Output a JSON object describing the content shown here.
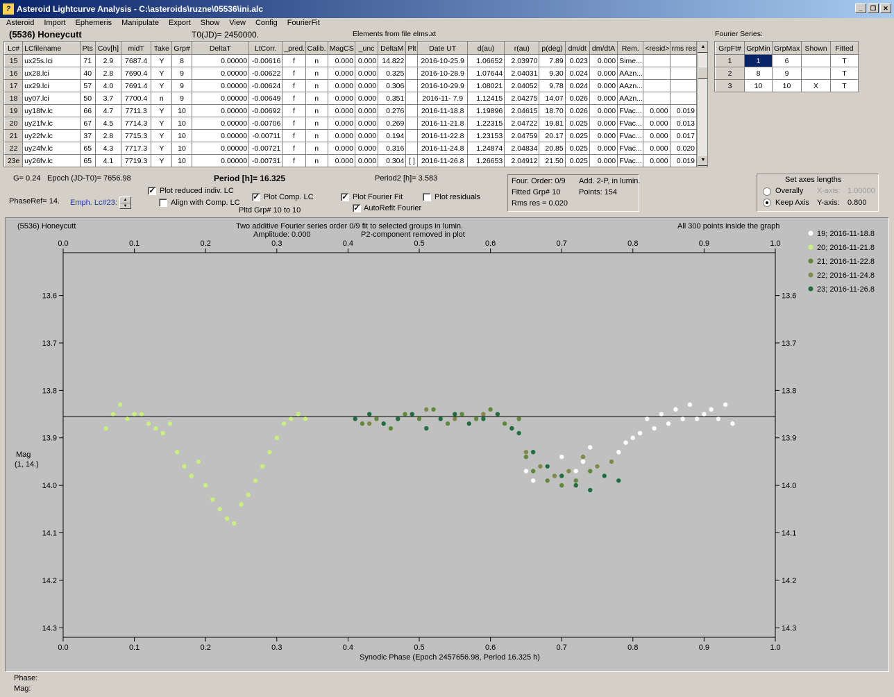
{
  "window": {
    "title": "Asteroid Lightcurve Analysis - C:\\asteroids\\ruzne\\05536\\ini.alc",
    "minimize": "_",
    "restore": "❐",
    "close": "✕"
  },
  "menu": [
    "Asteroid",
    "Import",
    "Ephemeris",
    "Manipulate",
    "Export",
    "Show",
    "View",
    "Config",
    "FourierFit"
  ],
  "header": {
    "asteroid": "(5536) Honeycutt",
    "t0": "T0(JD)= 2450000.",
    "elements": "Elements from file elms.xt",
    "fourier_series_label": "Fourier Series:"
  },
  "lc_table": {
    "columns": [
      "Lc#",
      "LCfilename",
      "Pts",
      "Cov[h]",
      "midT",
      "Take",
      "Grp#",
      "DeltaT",
      "LtCorr.",
      "_pred.",
      "Calib.",
      "MagCS",
      "_unc",
      "DeltaM",
      "Plt",
      "Date UT",
      "d(au)",
      "r(au)",
      "p(deg)",
      "dm/dt",
      "dm/dtA",
      "Rem.",
      "<resid>",
      "rms res"
    ],
    "rows": [
      [
        "15",
        "ux25s.lci",
        "71",
        "2.9",
        "7687.4",
        "Y",
        "8",
        "0.00000",
        "-0.00616",
        "f",
        "n",
        "0.000",
        "0.000",
        "14.822",
        "",
        "2016-10-25.9",
        "1.06652",
        "2.03970",
        "7.89",
        "0.023",
        "0.000",
        "Sime...",
        "",
        ""
      ],
      [
        "16",
        "ux28.lci",
        "40",
        "2.8",
        "7690.4",
        "Y",
        "9",
        "0.00000",
        "-0.00622",
        "f",
        "n",
        "0.000",
        "0.000",
        "0.325",
        "",
        "2016-10-28.9",
        "1.07644",
        "2.04031",
        "9.30",
        "0.024",
        "0.000",
        "AAzn...",
        "",
        ""
      ],
      [
        "17",
        "ux29.lci",
        "57",
        "4.0",
        "7691.4",
        "Y",
        "9",
        "0.00000",
        "-0.00624",
        "f",
        "n",
        "0.000",
        "0.000",
        "0.306",
        "",
        "2016-10-29.9",
        "1.08021",
        "2.04052",
        "9.78",
        "0.024",
        "0.000",
        "AAzn...",
        "",
        ""
      ],
      [
        "18",
        "uy07.lci",
        "50",
        "3.7",
        "7700.4",
        "n",
        "9",
        "0.00000",
        "-0.00649",
        "f",
        "n",
        "0.000",
        "0.000",
        "0.351",
        "",
        "2016-11- 7.9",
        "1.12415",
        "2.04275",
        "14.07",
        "0.026",
        "0.000",
        "AAzn...",
        "",
        ""
      ],
      [
        "19",
        "uy18fv.lc",
        "66",
        "4.7",
        "7711.3",
        "Y",
        "10",
        "0.00000",
        "-0.00692",
        "f",
        "n",
        "0.000",
        "0.000",
        "0.276",
        "",
        "2016-11-18.8",
        "1.19896",
        "2.04615",
        "18.70",
        "0.026",
        "0.000",
        "FVac...",
        "0.000",
        "0.019"
      ],
      [
        "20",
        "uy21fv.lc",
        "67",
        "4.5",
        "7714.3",
        "Y",
        "10",
        "0.00000",
        "-0.00706",
        "f",
        "n",
        "0.000",
        "0.000",
        "0.269",
        "",
        "2016-11-21.8",
        "1.22315",
        "2.04722",
        "19.81",
        "0.025",
        "0.000",
        "FVac...",
        "0.000",
        "0.013"
      ],
      [
        "21",
        "uy22fv.lc",
        "37",
        "2.8",
        "7715.3",
        "Y",
        "10",
        "0.00000",
        "-0.00711",
        "f",
        "n",
        "0.000",
        "0.000",
        "0.194",
        "",
        "2016-11-22.8",
        "1.23153",
        "2.04759",
        "20.17",
        "0.025",
        "0.000",
        "FVac...",
        "0.000",
        "0.017"
      ],
      [
        "22",
        "uy24fv.lc",
        "65",
        "4.3",
        "7717.3",
        "Y",
        "10",
        "0.00000",
        "-0.00721",
        "f",
        "n",
        "0.000",
        "0.000",
        "0.316",
        "",
        "2016-11-24.8",
        "1.24874",
        "2.04834",
        "20.85",
        "0.025",
        "0.000",
        "FVac...",
        "0.000",
        "0.020"
      ],
      [
        "23e",
        "uy26fv.lc",
        "65",
        "4.1",
        "7719.3",
        "Y",
        "10",
        "0.00000",
        "-0.00731",
        "f",
        "n",
        "0.000",
        "0.000",
        "0.304",
        "[ ]",
        "2016-11-26.8",
        "1.26653",
        "2.04912",
        "21.50",
        "0.025",
        "0.000",
        "FVac...",
        "0.000",
        "0.019"
      ]
    ]
  },
  "fourier_table": {
    "columns": [
      "GrpFt#",
      "GrpMin",
      "GrpMax",
      "Shown",
      "Fitted"
    ],
    "rows": [
      [
        "1",
        "1",
        "6",
        "",
        "T"
      ],
      [
        "2",
        "8",
        "9",
        "",
        "T"
      ],
      [
        "3",
        "10",
        "10",
        "X",
        "T"
      ]
    ]
  },
  "controls": {
    "g": "G= 0.24",
    "epoch": "Epoch (JD-T0)= 7656.98",
    "period": "Period [h]= 16.325",
    "period2": "Period2 [h]= 3.583",
    "phaseref": "PhaseRef= 14.",
    "emph": "Emph. Lc#23:",
    "plot_reduced": "Plot reduced indiv. LC",
    "align_comp": "Align with Comp. LC",
    "plot_comp": "Plot Comp. LC",
    "pltd_grp": "Pltd Grp#  10 to   10",
    "plot_fourier": "Plot Fourier Fit",
    "autorefit": "AutoRefit Fourier",
    "plot_residuals": "Plot residuals",
    "plot_reduced_checked": true,
    "align_comp_checked": false,
    "plot_comp_checked": true,
    "plot_fourier_checked": true,
    "autorefit_checked": true,
    "plot_residuals_checked": false,
    "four_order": "Four. Order:  0/9",
    "add2p": "Add. 2-P, in lumin.",
    "fitted_grp": "Fitted Grp# 10",
    "points": "Points: 154",
    "rms": "Rms res     = 0.020",
    "axes_title": "Set axes lengths",
    "overally": "Overally",
    "keep_axis": "Keep Axis",
    "xaxis": "X-axis:",
    "xaxis_val": "1.00000",
    "yaxis": "Y-axis:",
    "yaxis_val": "0.800"
  },
  "plot": {
    "name": "(5536) Honeycutt",
    "info1": "Two additive Fourier series order 0/9 fit to selected groups in lumin.",
    "info2": "Amplitude: 0.000",
    "info3": "P2-component removed in plot",
    "inside": "All 300 points inside the graph",
    "ylabel1": "Mag",
    "ylabel2": "(1, 14.)",
    "xlabel": "Synodic Phase (Epoch 2457656.98, Period 16.325 h)"
  },
  "chart_data": {
    "type": "scatter",
    "title": "(5536) Honeycutt",
    "xlabel": "Synodic Phase (Epoch 2457656.98, Period 16.325 h)",
    "ylabel": "Mag (1, 14.)",
    "xlim": [
      0,
      1
    ],
    "ylim": [
      14.32,
      13.51
    ],
    "y_inverted": true,
    "xticks": [
      "0.0",
      "0.1",
      "0.2",
      "0.3",
      "0.4",
      "0.5",
      "0.6",
      "0.7",
      "0.8",
      "0.9",
      "1.0"
    ],
    "yticks": [
      "13.6",
      "13.7",
      "13.8",
      "13.9",
      "14.0",
      "14.1",
      "14.2",
      "14.3"
    ],
    "fit_line_mag": 13.855,
    "legend": "right",
    "series": [
      {
        "name": "19; 2016-11-18.8",
        "color": "#ffffff",
        "points": [
          [
            0.65,
            13.97
          ],
          [
            0.66,
            13.99
          ],
          [
            0.68,
            13.96
          ],
          [
            0.7,
            13.94
          ],
          [
            0.72,
            13.97
          ],
          [
            0.73,
            13.95
          ],
          [
            0.74,
            13.92
          ],
          [
            0.75,
            13.96
          ],
          [
            0.76,
            13.98
          ],
          [
            0.77,
            13.95
          ],
          [
            0.78,
            13.93
          ],
          [
            0.79,
            13.91
          ],
          [
            0.8,
            13.9
          ],
          [
            0.81,
            13.89
          ],
          [
            0.82,
            13.86
          ],
          [
            0.83,
            13.88
          ],
          [
            0.84,
            13.85
          ],
          [
            0.85,
            13.87
          ],
          [
            0.86,
            13.84
          ],
          [
            0.87,
            13.86
          ],
          [
            0.88,
            13.83
          ],
          [
            0.89,
            13.86
          ],
          [
            0.9,
            13.85
          ],
          [
            0.91,
            13.84
          ],
          [
            0.92,
            13.86
          ],
          [
            0.93,
            13.83
          ],
          [
            0.94,
            13.87
          ]
        ]
      },
      {
        "name": "20; 2016-11-21.8",
        "color": "#c8f07a",
        "points": [
          [
            0.06,
            13.88
          ],
          [
            0.07,
            13.85
          ],
          [
            0.08,
            13.83
          ],
          [
            0.09,
            13.86
          ],
          [
            0.1,
            13.85
          ],
          [
            0.11,
            13.85
          ],
          [
            0.12,
            13.87
          ],
          [
            0.13,
            13.88
          ],
          [
            0.14,
            13.89
          ],
          [
            0.15,
            13.87
          ],
          [
            0.16,
            13.93
          ],
          [
            0.17,
            13.96
          ],
          [
            0.18,
            13.98
          ],
          [
            0.19,
            13.95
          ],
          [
            0.2,
            14.0
          ],
          [
            0.21,
            14.03
          ],
          [
            0.22,
            14.05
          ],
          [
            0.23,
            14.07
          ],
          [
            0.24,
            14.08
          ],
          [
            0.25,
            14.04
          ],
          [
            0.26,
            14.02
          ],
          [
            0.27,
            13.99
          ],
          [
            0.28,
            13.96
          ],
          [
            0.29,
            13.93
          ],
          [
            0.3,
            13.9
          ],
          [
            0.31,
            13.87
          ],
          [
            0.32,
            13.86
          ],
          [
            0.33,
            13.85
          ],
          [
            0.34,
            13.86
          ]
        ]
      },
      {
        "name": "21; 2016-11-22.8",
        "color": "#5e8a3a",
        "points": [
          [
            0.42,
            13.87
          ],
          [
            0.44,
            13.86
          ],
          [
            0.46,
            13.88
          ],
          [
            0.48,
            13.85
          ],
          [
            0.5,
            13.86
          ],
          [
            0.52,
            13.84
          ],
          [
            0.54,
            13.87
          ],
          [
            0.56,
            13.85
          ],
          [
            0.58,
            13.86
          ],
          [
            0.6,
            13.84
          ],
          [
            0.62,
            13.87
          ],
          [
            0.64,
            13.86
          ],
          [
            0.65,
            13.94
          ],
          [
            0.66,
            13.97
          ],
          [
            0.68,
            13.99
          ],
          [
            0.7,
            14.0
          ],
          [
            0.72,
            13.99
          ],
          [
            0.74,
            13.97
          ]
        ]
      },
      {
        "name": "22; 2016-11-24.8",
        "color": "#7d8a4a",
        "points": [
          [
            0.43,
            13.87
          ],
          [
            0.47,
            13.86
          ],
          [
            0.51,
            13.84
          ],
          [
            0.55,
            13.86
          ],
          [
            0.59,
            13.85
          ],
          [
            0.63,
            13.88
          ],
          [
            0.65,
            13.93
          ],
          [
            0.67,
            13.96
          ],
          [
            0.69,
            13.98
          ],
          [
            0.71,
            13.97
          ],
          [
            0.73,
            13.94
          ],
          [
            0.75,
            13.96
          ],
          [
            0.77,
            13.95
          ]
        ]
      },
      {
        "name": "23; 2016-11-26.8",
        "color": "#1e6e40",
        "points": [
          [
            0.41,
            13.86
          ],
          [
            0.43,
            13.85
          ],
          [
            0.45,
            13.87
          ],
          [
            0.47,
            13.86
          ],
          [
            0.49,
            13.85
          ],
          [
            0.51,
            13.88
          ],
          [
            0.53,
            13.86
          ],
          [
            0.55,
            13.85
          ],
          [
            0.57,
            13.87
          ],
          [
            0.59,
            13.86
          ],
          [
            0.61,
            13.85
          ],
          [
            0.63,
            13.88
          ],
          [
            0.64,
            13.89
          ],
          [
            0.66,
            13.93
          ],
          [
            0.68,
            13.96
          ],
          [
            0.7,
            13.98
          ],
          [
            0.72,
            14.0
          ],
          [
            0.74,
            14.01
          ],
          [
            0.76,
            13.98
          ],
          [
            0.78,
            13.99
          ]
        ]
      }
    ]
  },
  "status": {
    "phase": "Phase:",
    "mag": "Mag:"
  }
}
